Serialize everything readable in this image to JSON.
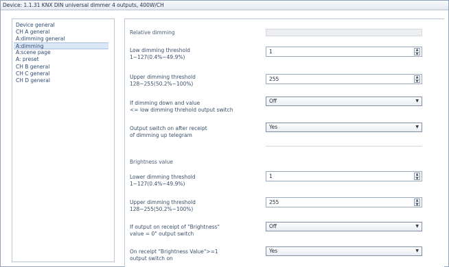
{
  "window": {
    "title": "Device: 1.1.31  KNX DIN universal dimmer 4 outputs, 400W/CH"
  },
  "sidebar": {
    "items": [
      {
        "label": "Device general"
      },
      {
        "label": "CH A general"
      },
      {
        "label": "A:dimming general"
      },
      {
        "label": "A:dimming"
      },
      {
        "label": "A:scene page"
      },
      {
        "label": "A: preset"
      },
      {
        "label": "CH B general"
      },
      {
        "label": "CH C general"
      },
      {
        "label": "CH D general"
      }
    ],
    "selected": "A:dimming"
  },
  "content": {
    "relative_dimming": {
      "label": "Relative dimming"
    },
    "low_threshold": {
      "label_line1": "Low dimming threshold",
      "label_line2": "1~127(0.4%~49.9%)",
      "value": "1"
    },
    "upper_threshold_1": {
      "label_line1": "Upper dimming threshold",
      "label_line2": "128~255(50.2%~100%)",
      "value": "255"
    },
    "dim_down_switch": {
      "label_line1": "If dimming down and value",
      "label_line2": "<= low dimming threhold output switch",
      "value": "Off"
    },
    "output_switch_on": {
      "label_line1": "Output switch on after receipt",
      "label_line2": "of dimming up telegram",
      "value": "Yes"
    },
    "brightness_value": {
      "label": "Brightness value"
    },
    "lower_threshold": {
      "label_line1": "Lower dimming threshold",
      "label_line2": "1~127(0.4%~49.9%)",
      "value": "1"
    },
    "upper_threshold_2": {
      "label_line1": "Upper dimming threshold",
      "label_line2": "128~255(50.2%~100%)",
      "value": "255"
    },
    "brightness_zero_switch": {
      "label_line1": "If output on receipt of \"Brightness\"",
      "label_line2": "value = 0\" output switch",
      "value": "Off"
    },
    "brightness_ge1_switch": {
      "label_line1": "On receipt \"Brightness  Value\">=1",
      "label_line2": "output switch on",
      "value": "Yes"
    }
  },
  "icons": {
    "spin_up": "▲",
    "spin_down": "▼",
    "dropdown": "▼"
  }
}
